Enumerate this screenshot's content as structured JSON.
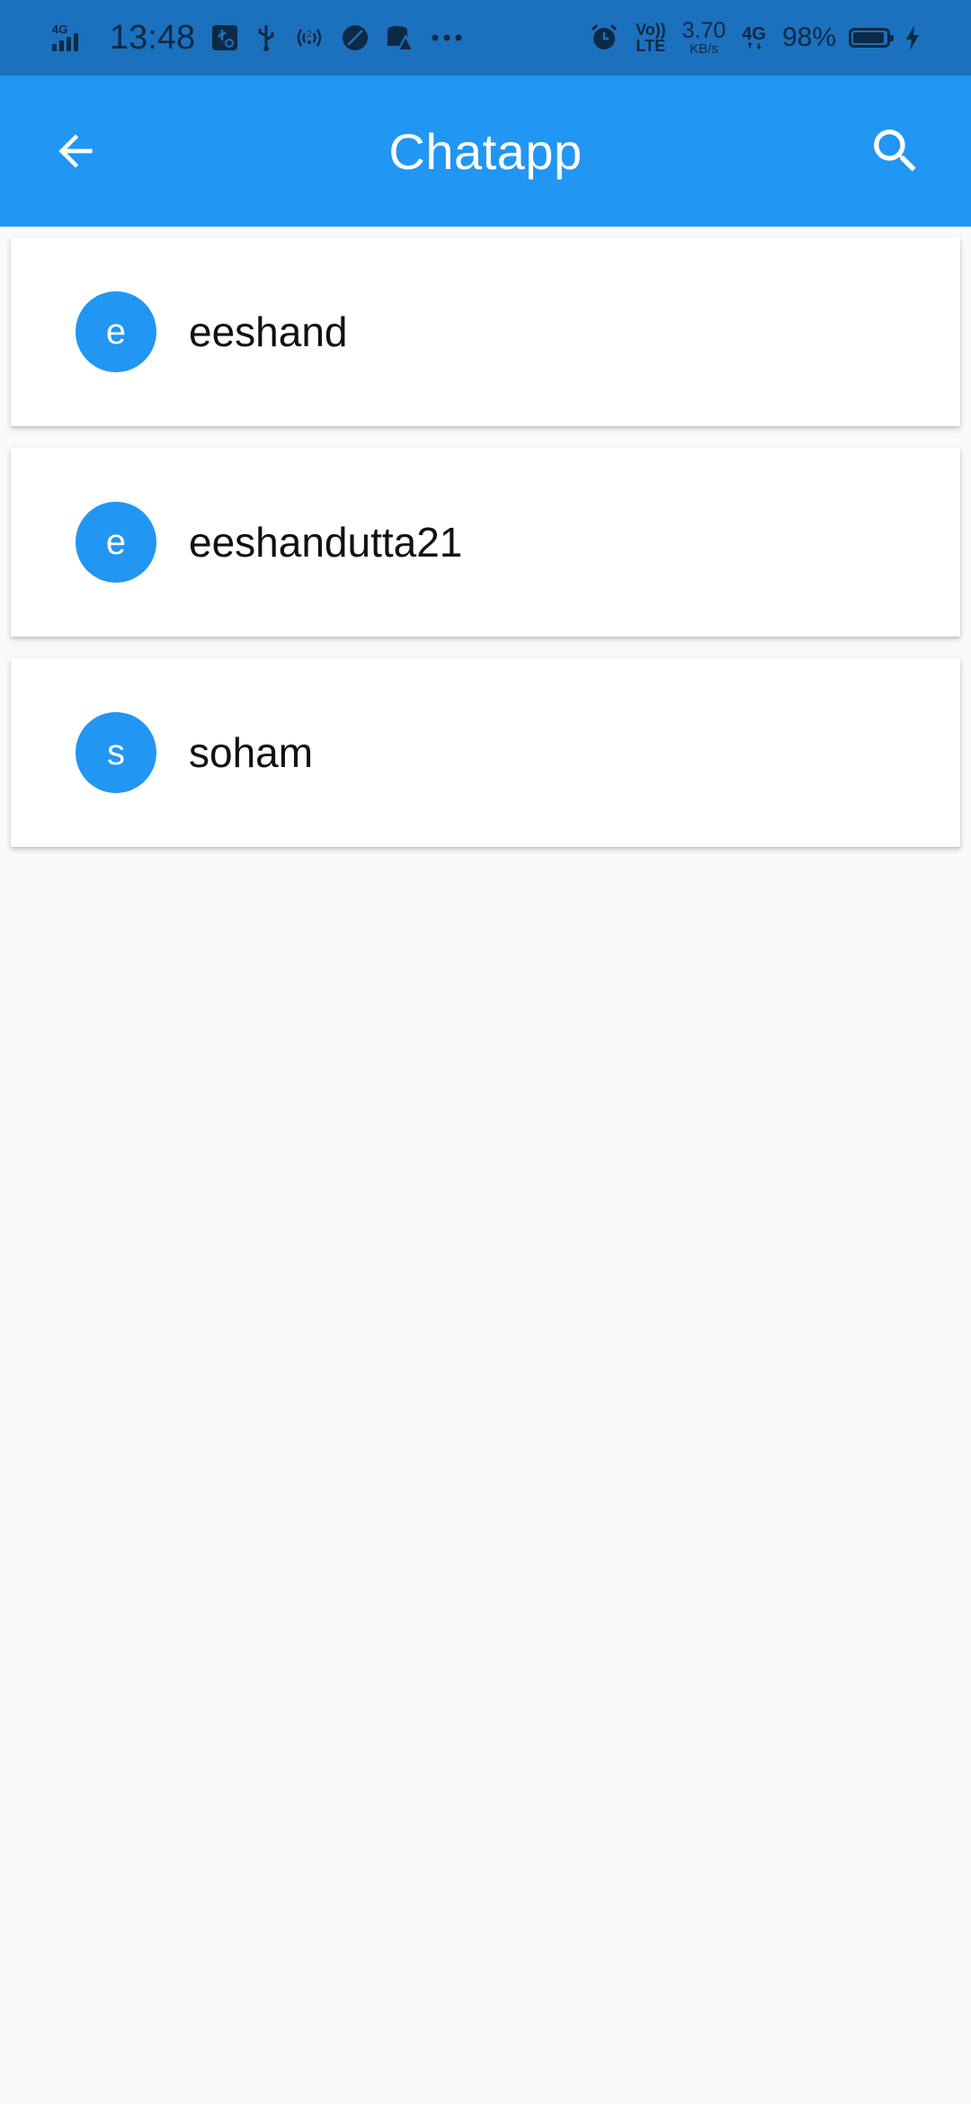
{
  "status_bar": {
    "network_type": "4G",
    "time": "13:48",
    "volte_top": "Vo))",
    "volte_bottom": "LTE",
    "speed_value": "3.70",
    "speed_unit": "KB/s",
    "network_type_2": "4G",
    "battery_percent": "98%",
    "icons": [
      "signal-icon",
      "usb-debug-icon",
      "usb-icon",
      "hotspot-icon",
      "leaf-icon",
      "storage-warning-icon",
      "more-icon",
      "alarm-icon",
      "battery-icon",
      "charging-icon"
    ]
  },
  "app_bar": {
    "title": "Chatapp",
    "back_icon": "arrow-back-icon",
    "search_icon": "search-icon"
  },
  "users": [
    {
      "initial": "e",
      "name": "eeshand"
    },
    {
      "initial": "e",
      "name": "eeshandutta21"
    },
    {
      "initial": "s",
      "name": "soham"
    }
  ],
  "colors": {
    "status_bar": "#1b71bd",
    "app_bar": "#2196f3",
    "avatar": "#2196f3",
    "background": "#fafafa"
  }
}
